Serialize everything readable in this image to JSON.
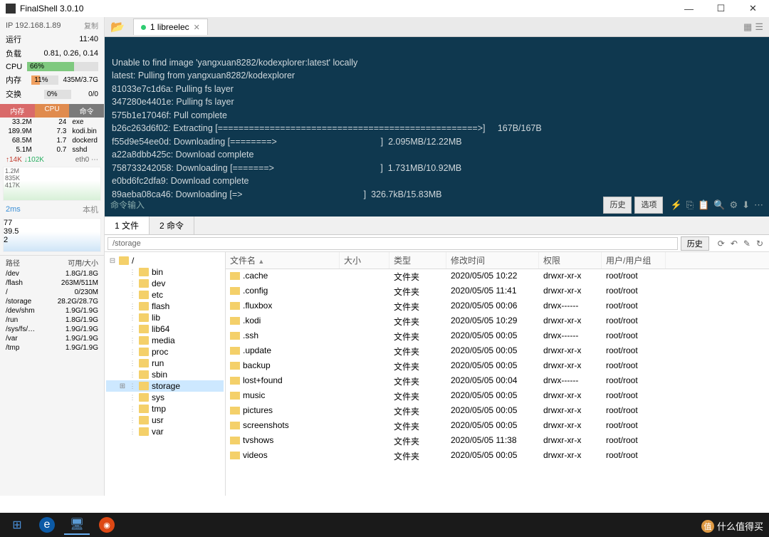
{
  "title": "FinalShell 3.0.10",
  "window": {
    "min": "—",
    "max": "☐",
    "close": "✕"
  },
  "sidebar": {
    "ip": "IP 192.168.1.89",
    "copy": "复制",
    "uptime_label": "运行",
    "uptime": "11:40",
    "load_label": "负载",
    "load": "0.81, 0.26, 0.14",
    "cpu_label": "CPU",
    "cpu_pct": "66%",
    "mem_label": "内存",
    "mem_pct": "11%",
    "mem_val": "435M/3.7G",
    "swap_label": "交换",
    "swap_pct": "0%",
    "swap_val": "0/0",
    "proc_h": {
      "mem": "内存",
      "cpu": "CPU",
      "cmd": "命令"
    },
    "procs": [
      {
        "mem": "33.2M",
        "cpu": "24",
        "cmd": "exe"
      },
      {
        "mem": "189.9M",
        "cpu": "7.3",
        "cmd": "kodi.bin"
      },
      {
        "mem": "68.5M",
        "cpu": "1.7",
        "cmd": "dockerd"
      },
      {
        "mem": "5.1M",
        "cpu": "0.7",
        "cmd": "sshd"
      }
    ],
    "net": {
      "up": "↑14K",
      "down": "↓102K",
      "iface": "eth0 ⋯"
    },
    "chart1_y": [
      "1.2M",
      "835K",
      "417K"
    ],
    "chart2_label": "2ms",
    "chart2_right": "本机",
    "chart2_y": [
      "77",
      "39.5",
      "2"
    ],
    "disk_h": {
      "path": "路径",
      "size": "可用/大小"
    },
    "disks": [
      {
        "path": "/dev",
        "size": "1.8G/1.8G"
      },
      {
        "path": "/flash",
        "size": "263M/511M"
      },
      {
        "path": "/",
        "size": "0/230M"
      },
      {
        "path": "/storage",
        "size": "28.2G/28.7G"
      },
      {
        "path": "/dev/shm",
        "size": "1.9G/1.9G"
      },
      {
        "path": "/run",
        "size": "1.8G/1.9G"
      },
      {
        "path": "/sys/fs/…",
        "size": "1.9G/1.9G"
      },
      {
        "path": "/var",
        "size": "1.9G/1.9G"
      },
      {
        "path": "/tmp",
        "size": "1.9G/1.9G"
      }
    ]
  },
  "tab": {
    "label": "1 libreelec"
  },
  "terminal_lines": [
    "Unable to find image 'yangxuan8282/kodexplorer:latest' locally",
    "latest: Pulling from yangxuan8282/kodexplorer",
    "81033e7c1d6a: Pulling fs layer",
    "347280e4401e: Pulling fs layer",
    "575b1e17046f: Pull complete",
    "b26c263d6f02: Extracting [==================================================>]     167B/167B",
    "f55d9e54ee0d: Downloading [========>                                          ]  2.095MB/12.22MB",
    "a22a8dbb425c: Download complete",
    "758733242058: Downloading [=======>                                           ]  1.731MB/10.92MB",
    "e0bd6fc2dfa9: Download complete",
    "89aeba08ca46: Downloading [=>                                                 ]  326.7kB/15.83MB"
  ],
  "term_input": "命令输入",
  "term_btn": {
    "history": "历史",
    "options": "选项"
  },
  "filetabs": {
    "files": "1 文件",
    "cmd": "2 命令"
  },
  "path": "/storage",
  "path_history": "历史",
  "tree_root": "/",
  "tree": [
    "bin",
    "dev",
    "etc",
    "flash",
    "lib",
    "lib64",
    "media",
    "proc",
    "run",
    "sbin",
    "storage",
    "sys",
    "tmp",
    "usr",
    "var"
  ],
  "cols": {
    "name": "文件名",
    "size": "大小",
    "type": "类型",
    "date": "修改时间",
    "perm": "权限",
    "user": "用户/用户组"
  },
  "files": [
    {
      "name": ".cache",
      "type": "文件夹",
      "date": "2020/05/05 10:22",
      "perm": "drwxr-xr-x",
      "user": "root/root"
    },
    {
      "name": ".config",
      "type": "文件夹",
      "date": "2020/05/05 11:41",
      "perm": "drwxr-xr-x",
      "user": "root/root"
    },
    {
      "name": ".fluxbox",
      "type": "文件夹",
      "date": "2020/05/05 00:06",
      "perm": "drwx------",
      "user": "root/root"
    },
    {
      "name": ".kodi",
      "type": "文件夹",
      "date": "2020/05/05 10:29",
      "perm": "drwxr-xr-x",
      "user": "root/root"
    },
    {
      "name": ".ssh",
      "type": "文件夹",
      "date": "2020/05/05 00:05",
      "perm": "drwx------",
      "user": "root/root"
    },
    {
      "name": ".update",
      "type": "文件夹",
      "date": "2020/05/05 00:05",
      "perm": "drwxr-xr-x",
      "user": "root/root"
    },
    {
      "name": "backup",
      "type": "文件夹",
      "date": "2020/05/05 00:05",
      "perm": "drwxr-xr-x",
      "user": "root/root"
    },
    {
      "name": "lost+found",
      "type": "文件夹",
      "date": "2020/05/05 00:04",
      "perm": "drwx------",
      "user": "root/root"
    },
    {
      "name": "music",
      "type": "文件夹",
      "date": "2020/05/05 00:05",
      "perm": "drwxr-xr-x",
      "user": "root/root"
    },
    {
      "name": "pictures",
      "type": "文件夹",
      "date": "2020/05/05 00:05",
      "perm": "drwxr-xr-x",
      "user": "root/root"
    },
    {
      "name": "screenshots",
      "type": "文件夹",
      "date": "2020/05/05 00:05",
      "perm": "drwxr-xr-x",
      "user": "root/root"
    },
    {
      "name": "tvshows",
      "type": "文件夹",
      "date": "2020/05/05 11:38",
      "perm": "drwxr-xr-x",
      "user": "root/root"
    },
    {
      "name": "videos",
      "type": "文件夹",
      "date": "2020/05/05 00:05",
      "perm": "drwxr-xr-x",
      "user": "root/root"
    }
  ],
  "watermark": "什么值得买"
}
